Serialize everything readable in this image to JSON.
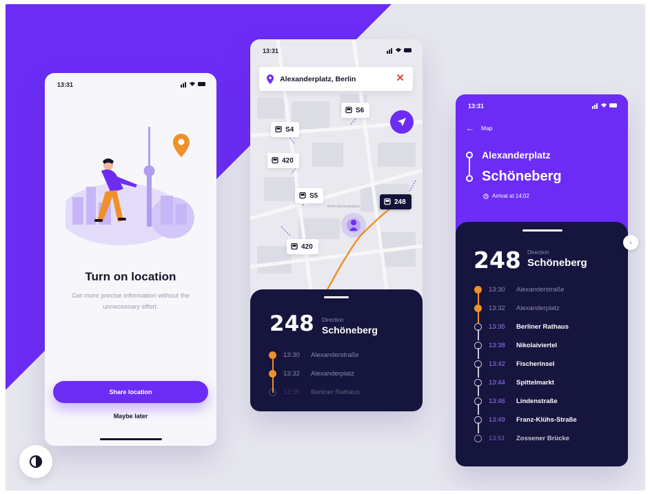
{
  "colors": {
    "accent": "#6c2cf5",
    "navy": "#15153d",
    "orange": "#f0902a",
    "stop_done": "#8a88b8",
    "stop_upcoming": "#ffffff",
    "time_upcoming": "#9b7cf5"
  },
  "screen1": {
    "time": "13:31",
    "title": "Turn on location",
    "description": "Get more precise information without the unnecessary effort.",
    "primary_button": "Share location",
    "secondary_button": "Maybe later"
  },
  "screen2": {
    "time": "13:31",
    "search_value": "Alexanderplatz, Berlin",
    "map_place_label": "Berlin Alexanderplatz",
    "stop_tags": [
      "S6",
      "S4",
      "420",
      "S5",
      "248",
      "420"
    ],
    "route_number": "248",
    "direction_label": "Direction",
    "direction_value": "Schöneberg",
    "stops": [
      {
        "time": "13:30",
        "name": "Alexanderstraße",
        "status": "done"
      },
      {
        "time": "13:32",
        "name": "Alexanderplatz",
        "status": "done"
      },
      {
        "time": "13:35",
        "name": "Berliner Rathaus",
        "status": "upcoming"
      }
    ]
  },
  "screen3": {
    "time": "13:31",
    "back_label": "Map",
    "trip_from": "Alexanderplatz",
    "trip_to": "Schöneberg",
    "arrival_text": "Arrival at 14:02",
    "route_number": "248",
    "direction_label": "Direction",
    "direction_value": "Schöneberg",
    "stops": [
      {
        "time": "13:30",
        "name": "Alexanderstraße",
        "status": "done"
      },
      {
        "time": "13:32",
        "name": "Alexanderplatz",
        "status": "done"
      },
      {
        "time": "13:35",
        "name": "Berliner Rathaus",
        "status": "upcoming"
      },
      {
        "time": "13:38",
        "name": "Nikolaiviertel",
        "status": "upcoming"
      },
      {
        "time": "13:42",
        "name": "Fischerinsel",
        "status": "upcoming"
      },
      {
        "time": "13:44",
        "name": "Spittelmarkt",
        "status": "upcoming"
      },
      {
        "time": "13:46",
        "name": "Lindenstraße",
        "status": "upcoming"
      },
      {
        "time": "13:49",
        "name": "Franz-Klühs-Straße",
        "status": "upcoming"
      },
      {
        "time": "13:51",
        "name": "Zossener Brücke",
        "status": "upcoming"
      }
    ]
  },
  "icons": {
    "next": "chevron-right-icon",
    "theme": "contrast-icon",
    "locate": "navigation-arrow-icon",
    "search_pin": "location-pin-icon",
    "clear": "close-icon",
    "back": "arrow-left-icon",
    "arrival": "clock-icon"
  }
}
